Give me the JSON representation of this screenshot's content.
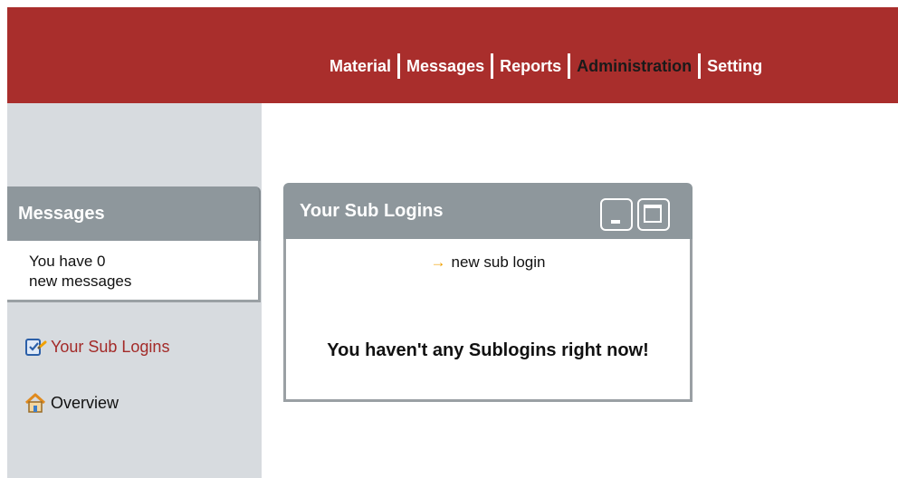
{
  "header": {
    "nav": [
      {
        "label": "Material"
      },
      {
        "label": "Messages"
      },
      {
        "label": "Reports"
      },
      {
        "label": "Administration"
      },
      {
        "label": "Setting"
      }
    ],
    "bg_color": "#a92e2c",
    "active_color": "#1a1a1a"
  },
  "sidebar": {
    "messages": {
      "title": "Messages",
      "line1": "You have 0",
      "line2": "new messages"
    },
    "links": [
      {
        "label": "Your Sub Logins",
        "icon": "edit-user-icon",
        "color": "#a32a28"
      },
      {
        "label": "Overview",
        "icon": "home-icon"
      }
    ]
  },
  "panel": {
    "title": "Your Sub Logins",
    "new_link_arrow": "→",
    "new_link_label": "new sub login",
    "empty_message": "You haven't any Sublogins right now!"
  }
}
